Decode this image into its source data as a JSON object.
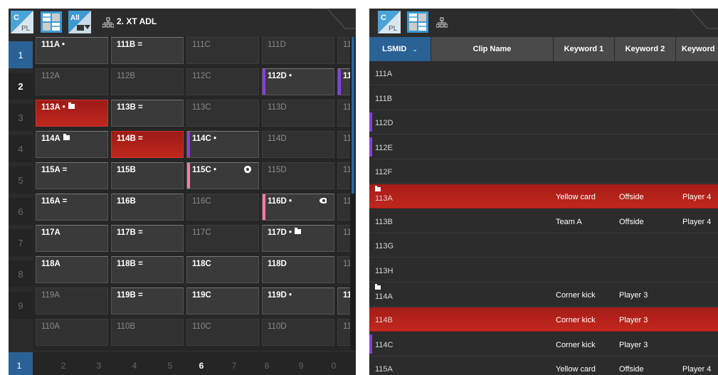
{
  "left": {
    "toolbar": {
      "title": "2. XT ADL",
      "cpl_icon_text_top": "C",
      "cpl_icon_text_bottom": "PL",
      "all_icon_text": "All"
    },
    "row_numbers": [
      "1",
      "2",
      "3",
      "4",
      "5",
      "6",
      "7",
      "8",
      "9"
    ],
    "grid": [
      [
        {
          "label": "111A •",
          "style": "normal"
        },
        {
          "label": "111B =",
          "style": "normal"
        },
        {
          "label": "111C",
          "style": "dim"
        },
        {
          "label": "111D",
          "style": "dim"
        },
        {
          "label": "11",
          "style": "dim"
        }
      ],
      [
        {
          "label": "112A",
          "style": "dim"
        },
        {
          "label": "112B",
          "style": "dim"
        },
        {
          "label": "112C",
          "style": "dim"
        },
        {
          "label": "112D •",
          "style": "normal",
          "mark": "purple"
        },
        {
          "label": "11",
          "style": "normal",
          "mark": "purple"
        }
      ],
      [
        {
          "label": "113A •",
          "style": "red",
          "folder": true
        },
        {
          "label": "113B =",
          "style": "normal"
        },
        {
          "label": "113C",
          "style": "dim"
        },
        {
          "label": "113D",
          "style": "dim"
        },
        {
          "label": "11",
          "style": "dim"
        }
      ],
      [
        {
          "label": "114A",
          "style": "normal",
          "folder": true
        },
        {
          "label": "114B =",
          "style": "red"
        },
        {
          "label": "114C •",
          "style": "normal",
          "mark": "purple"
        },
        {
          "label": "114D",
          "style": "dim"
        },
        {
          "label": "11",
          "style": "dim"
        }
      ],
      [
        {
          "label": "115A =",
          "style": "normal"
        },
        {
          "label": "115B",
          "style": "normal"
        },
        {
          "label": "115C •",
          "style": "normal",
          "mark": "pink",
          "icon": "pin"
        },
        {
          "label": "115D",
          "style": "dim"
        },
        {
          "label": "11",
          "style": "dim"
        }
      ],
      [
        {
          "label": "116A =",
          "style": "normal"
        },
        {
          "label": "116B",
          "style": "normal"
        },
        {
          "label": "116C",
          "style": "dim"
        },
        {
          "label": "116D •",
          "style": "normal",
          "mark": "pink",
          "icon": "eye"
        },
        {
          "label": "11",
          "style": "dim"
        }
      ],
      [
        {
          "label": "117A",
          "style": "normal"
        },
        {
          "label": "117B =",
          "style": "normal"
        },
        {
          "label": "117C",
          "style": "dim"
        },
        {
          "label": "117D •",
          "style": "normal",
          "folder": true
        },
        {
          "label": "11",
          "style": "dim"
        }
      ],
      [
        {
          "label": "118A",
          "style": "normal"
        },
        {
          "label": "118B =",
          "style": "normal"
        },
        {
          "label": "118C",
          "style": "normal"
        },
        {
          "label": "118D",
          "style": "normal"
        },
        {
          "label": "11",
          "style": "dim"
        }
      ],
      [
        {
          "label": "119A",
          "style": "dim"
        },
        {
          "label": "119B =",
          "style": "normal"
        },
        {
          "label": "119C",
          "style": "normal"
        },
        {
          "label": "119D •",
          "style": "normal"
        },
        {
          "label": "11",
          "style": "normal"
        }
      ],
      [
        {
          "label": "110A",
          "style": "dim"
        },
        {
          "label": "110B",
          "style": "dim"
        },
        {
          "label": "110C",
          "style": "dim"
        },
        {
          "label": "110D",
          "style": "dim"
        },
        {
          "label": "11",
          "style": "dim"
        }
      ]
    ],
    "pager": [
      "1",
      "2",
      "3",
      "4",
      "5",
      "6",
      "7",
      "8",
      "9",
      "0"
    ]
  },
  "right": {
    "toolbar": {
      "cpl_icon_text_top": "C",
      "cpl_icon_text_bottom": "PL"
    },
    "headers": [
      "LSMID",
      "Clip Name",
      "Keyword 1",
      "Keyword 2",
      "Keyword"
    ],
    "rows": [
      {
        "id": "111A",
        "k1": "",
        "k2": "",
        "k3": ""
      },
      {
        "id": "111B",
        "k1": "",
        "k2": "",
        "k3": ""
      },
      {
        "id": "112D",
        "k1": "",
        "k2": "",
        "k3": "",
        "mark": true
      },
      {
        "id": "112E",
        "k1": "",
        "k2": "",
        "k3": "",
        "mark": true
      },
      {
        "id": "112F",
        "k1": "",
        "k2": "",
        "k3": ""
      },
      {
        "id": "113A",
        "k1": "Yellow card",
        "k2": "Offside",
        "k3": "Player 4",
        "red": true,
        "folder": true
      },
      {
        "id": "113B",
        "k1": "Team A",
        "k2": "Offside",
        "k3": "Player 4"
      },
      {
        "id": "113G",
        "k1": "",
        "k2": "",
        "k3": ""
      },
      {
        "id": "113H",
        "k1": "",
        "k2": "",
        "k3": ""
      },
      {
        "id": "114A",
        "k1": "Corner kick",
        "k2": "Player 3",
        "k3": "",
        "folder": true
      },
      {
        "id": "114B",
        "k1": "Corner kick",
        "k2": "Player 3",
        "k3": "",
        "red": true
      },
      {
        "id": "114C",
        "k1": "Corner kick",
        "k2": "Player 3",
        "k3": "",
        "mark": true
      },
      {
        "id": "115A",
        "k1": "Yellow card",
        "k2": "Offside",
        "k3": "Player 4"
      }
    ]
  },
  "colors": {
    "accent_blue": "#2a6296",
    "red": "#c1271d",
    "purple": "#8a3ee0",
    "pink": "#ff7aa8"
  }
}
